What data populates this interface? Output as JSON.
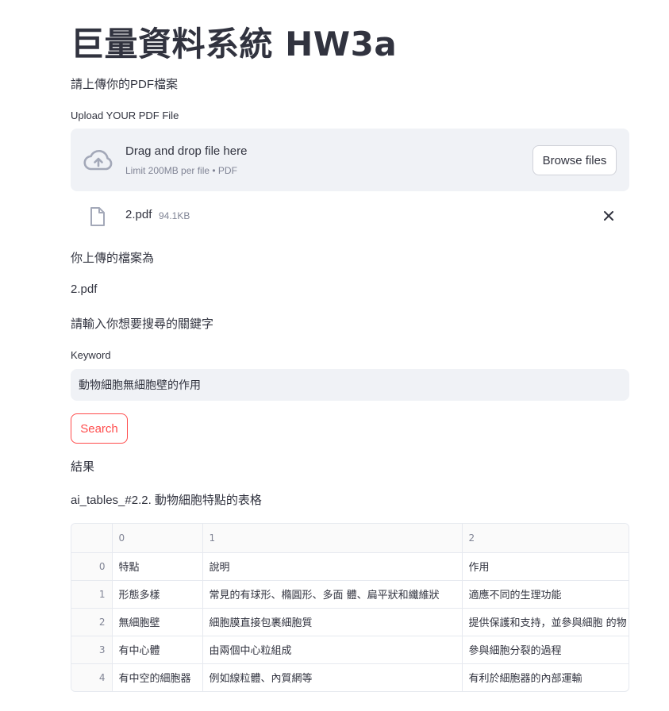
{
  "title": "巨量資料系統 HW3a",
  "prompt_upload": "請上傳你的PDF檔案",
  "uploader": {
    "label": "Upload YOUR PDF File",
    "drag_text": "Drag and drop file here",
    "limit_text": "Limit 200MB per file • PDF",
    "browse_label": "Browse files",
    "file": {
      "name": "2.pdf",
      "size": "94.1KB"
    }
  },
  "uploaded_label": "你上傳的檔案為",
  "uploaded_name": "2.pdf",
  "prompt_keyword": "請輸入你想要搜尋的關鍵字",
  "keyword": {
    "label": "Keyword",
    "value": "動物細胞無細胞壁的作用"
  },
  "search_label": "Search",
  "result_label": "結果",
  "result_title": "ai_tables_#2.2. 動物細胞特點的表格",
  "table": {
    "columns": [
      "",
      "0",
      "1",
      "2"
    ],
    "rows": [
      [
        "0",
        "特點",
        "說明",
        "作用"
      ],
      [
        "1",
        "形態多樣",
        "常見的有球形、橢圓形、多面 體、扁平狀和纖維狀",
        "適應不同的生理功能"
      ],
      [
        "2",
        "無細胞壁",
        "細胞膜直接包裹細胞質",
        "提供保護和支持，並參與細胞 的物"
      ],
      [
        "3",
        "有中心體",
        "由兩個中心粒組成",
        "參與細胞分裂的過程"
      ],
      [
        "4",
        "有中空的細胞器",
        "例如線粒體、內質網等",
        "有利於細胞器的內部運輸"
      ]
    ]
  },
  "colors": {
    "accent": "#ff4b4b",
    "input_bg": "#f0f2f6",
    "text": "#31333f",
    "muted": "#808495"
  }
}
